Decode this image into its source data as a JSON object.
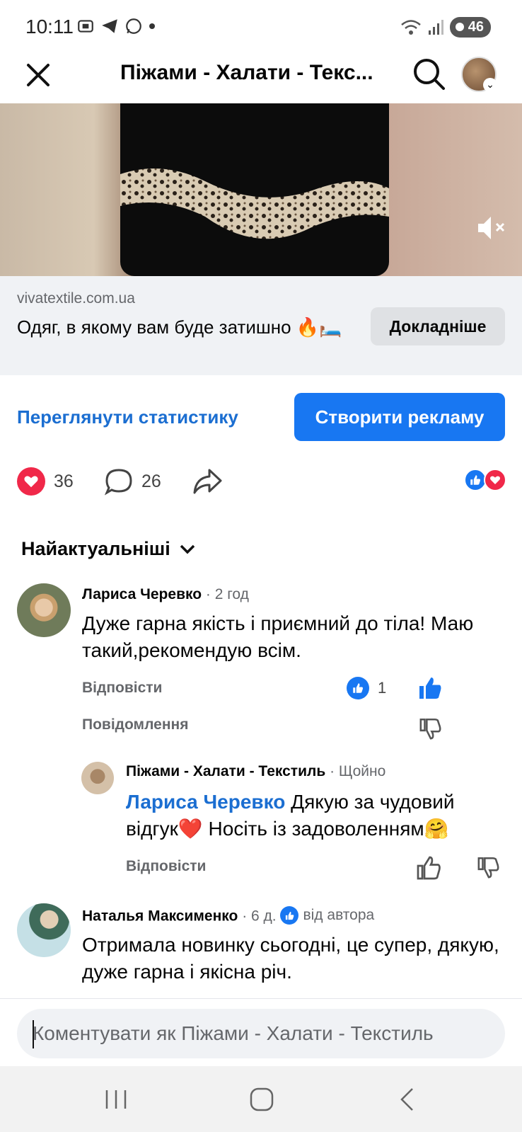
{
  "status_bar": {
    "time": "10:11",
    "battery": "46"
  },
  "header": {
    "title": "Піжами - Халати - Текс..."
  },
  "ad": {
    "domain": "vivatextile.com.ua",
    "headline": "Одяг, в якому вам буде затишно 🔥🛏️",
    "cta_label": "Докладніше"
  },
  "actions": {
    "stats_label": "Переглянути статистику",
    "create_ad_label": "Створити рекламу"
  },
  "reactions": {
    "likes": "36",
    "comments": "26"
  },
  "sort": {
    "label": "Найактуальніші"
  },
  "comments": [
    {
      "author": "Лариса Черевко",
      "time": "· 2 год",
      "text": "Дуже гарна якість і приємний до тіла! Маю такий,рекомендую всім.",
      "reply_label": "Відповісти",
      "message_label": "Повідомлення",
      "like_count": "1"
    },
    {
      "author": "Піжами - Халати - Текстиль",
      "time": "· Щойно",
      "mention": "Лариса Черевко",
      "text": " Дякую за чудовий відгук❤️ Носіть із задоволенням🤗",
      "reply_label": "Відповісти"
    },
    {
      "author": "Наталья Максименко",
      "time": "· 6 д.",
      "badge": "від автора",
      "text": "Отримала новинку сьогодні, це супер, дякую, дуже гарна і якісна річ."
    }
  ],
  "composer": {
    "placeholder": "Коментувати як Піжами - Халати - Текстиль"
  },
  "colors": {
    "facebook_blue": "#1877f2",
    "link_blue": "#1b6ed1",
    "love_red": "#f02849",
    "muted_gray": "#65676b"
  }
}
